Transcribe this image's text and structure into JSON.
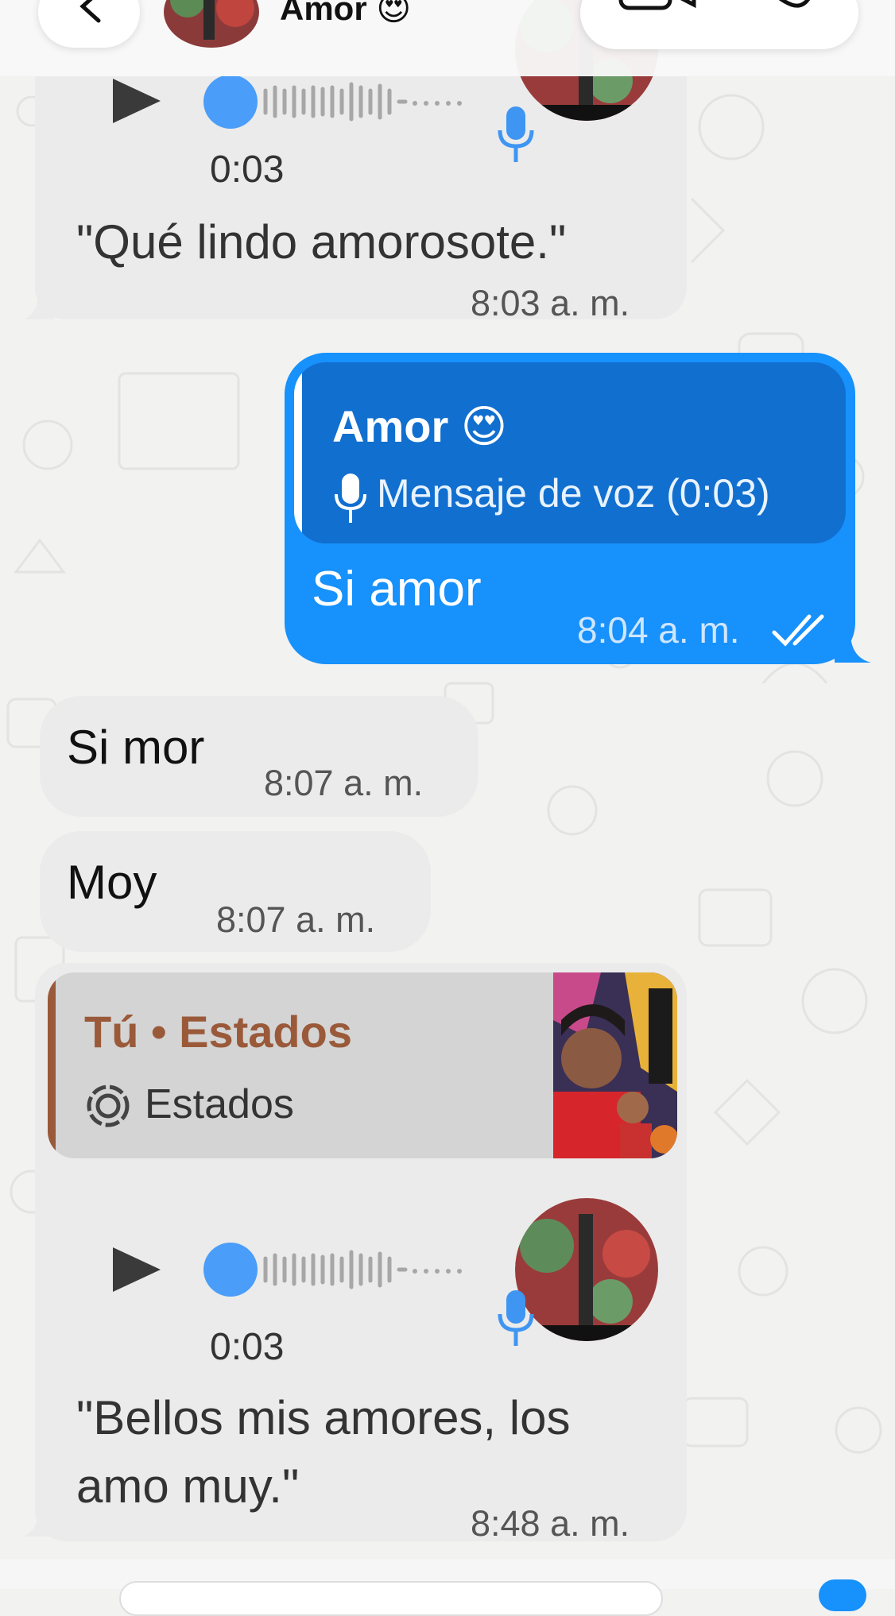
{
  "header": {
    "contact_name": "Amor 😍",
    "back_icon": "chevron-left-icon",
    "video_icon": "video-call-icon",
    "phone_icon": "phone-icon"
  },
  "messages": {
    "m1": {
      "duration": "0:03",
      "transcript": "\"Qué lindo amorosote.\"",
      "time": "8:03 a. m."
    },
    "m2": {
      "quote_author": "Amor 😍",
      "quote_text": "Mensaje de voz (0:03)",
      "text": "Si amor",
      "time": "8:04 a. m."
    },
    "m3": {
      "text": "Si mor",
      "time": "8:07 a. m."
    },
    "m4": {
      "text": "Moy",
      "time": "8:07 a. m."
    },
    "m5": {
      "quote_author": "Tú • Estados",
      "quote_text": "Estados",
      "duration": "0:03",
      "transcript_line1": "\"Bellos mis amores, los",
      "transcript_line2": "amo muy.\"",
      "time": "8:48 a. m."
    }
  },
  "colors": {
    "outgoing": "#1791fb",
    "incoming": "#ebebeb",
    "status_quote_accent": "#9a5a3a",
    "voice_dot": "#4a9df8"
  }
}
